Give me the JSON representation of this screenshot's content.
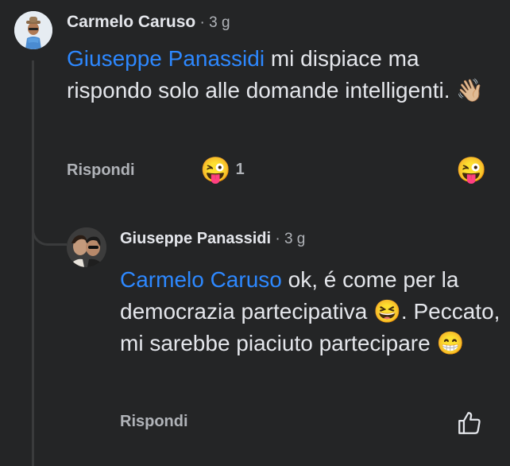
{
  "comment1": {
    "author": "Carmelo Caruso",
    "time": " · 3 g",
    "mention": "Giuseppe Panassidi",
    "text": " mi dispiace ma rispondo solo alle domande intelligenti. ",
    "emoji": "👋🏼",
    "reply_label": "Rispondi",
    "reaction_emoji": "😜",
    "reaction_count": "1",
    "react_emoji": "😜"
  },
  "comment2": {
    "author": "Giuseppe Panassidi",
    "time": " · 3 g",
    "mention": "Carmelo Caruso",
    "text_part1": " ok, é come per la democrazia partecipativa ",
    "emoji1": "😆",
    "text_part2": ". Peccato, mi sarebbe piaciuto partecipare ",
    "emoji2": "😁",
    "reply_label": "Rispondi"
  },
  "icons": {
    "like": "thumbs-up-outline-icon"
  },
  "colors": {
    "background": "#242526",
    "text": "#e4e6eb",
    "secondary_text": "#b0b3b8",
    "mention": "#2d88ff",
    "thread_line": "#3a3b3c"
  }
}
